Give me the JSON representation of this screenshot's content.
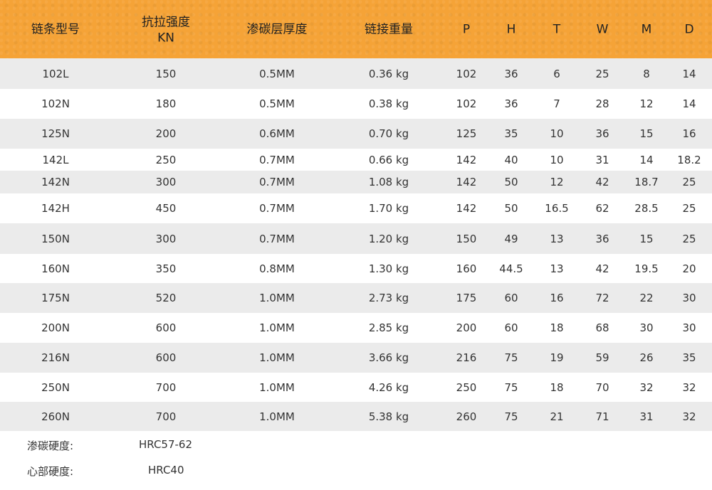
{
  "headers": [
    "链条型号",
    "抗拉强度",
    "KN",
    "渗碳层厚度",
    "链接重量",
    "P",
    "H",
    "T",
    "W",
    "M",
    "D"
  ],
  "rows": [
    [
      "102L",
      "150",
      "0.5MM",
      "0.36 kg",
      "102",
      "36",
      "6",
      "25",
      "8",
      "14"
    ],
    [
      "102N",
      "180",
      "0.5MM",
      "0.38 kg",
      "102",
      "36",
      "7",
      "28",
      "12",
      "14"
    ],
    [
      "125N",
      "200",
      "0.6MM",
      "0.70 kg",
      "125",
      "35",
      "10",
      "36",
      "15",
      "16"
    ],
    [
      "142L",
      "250",
      "0.7MM",
      "0.66 kg",
      "142",
      "40",
      "10",
      "31",
      "14",
      "18.2"
    ],
    [
      "142N",
      "300",
      "0.7MM",
      "1.08 kg",
      "142",
      "50",
      "12",
      "42",
      "18.7",
      "25"
    ],
    [
      "142H",
      "450",
      "0.7MM",
      "1.70 kg",
      "142",
      "50",
      "16.5",
      "62",
      "28.5",
      "25"
    ],
    [
      "150N",
      "300",
      "0.7MM",
      "1.20 kg",
      "150",
      "49",
      "13",
      "36",
      "15",
      "25"
    ],
    [
      "160N",
      "350",
      "0.8MM",
      "1.30 kg",
      "160",
      "44.5",
      "13",
      "42",
      "19.5",
      "20"
    ],
    [
      "175N",
      "520",
      "1.0MM",
      "2.73 kg",
      "175",
      "60",
      "16",
      "72",
      "22",
      "30"
    ],
    [
      "200N",
      "600",
      "1.0MM",
      "2.85 kg",
      "200",
      "60",
      "18",
      "68",
      "30",
      "30"
    ],
    [
      "216N",
      "600",
      "1.0MM",
      "3.66 kg",
      "216",
      "75",
      "19",
      "59",
      "26",
      "35"
    ],
    [
      "250N",
      "700",
      "1.0MM",
      "4.26 kg",
      "250",
      "75",
      "18",
      "70",
      "32",
      "32"
    ],
    [
      "260N",
      "700",
      "1.0MM",
      "5.38 kg",
      "260",
      "75",
      "21",
      "71",
      "31",
      "32"
    ]
  ],
  "footer": {
    "surface_label": "渗碳硬度:",
    "surface_value": "HRC57-62",
    "core_label": "心部硬度:",
    "core_value": "HRC40"
  },
  "colors": {
    "header_bg": "#f5a337",
    "stripe_bg": "#ebebeb"
  }
}
